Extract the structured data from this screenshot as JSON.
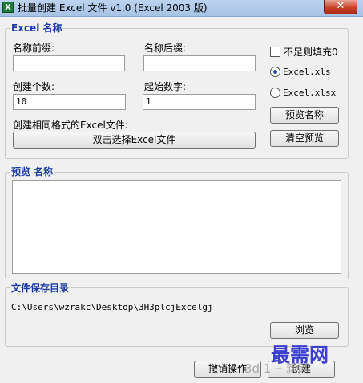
{
  "window": {
    "title": "批量创建 Excel 文件 v1.0 (Excel 2003 版)",
    "icon_text": "X",
    "close_glyph": "✕"
  },
  "name_group": {
    "title": "Excel 名称",
    "prefix_label": "名称前缀:",
    "prefix_value": "",
    "suffix_label": "名称后缀:",
    "suffix_value": "",
    "count_label": "创建个数:",
    "count_value": "10",
    "start_label": "起始数字:",
    "start_value": "1",
    "template_label": "创建相同格式的Excel文件:",
    "template_button": "双击选择Excel文件",
    "pad_checkbox_label": "不足则填充0",
    "pad_checked": false,
    "format_options": [
      "Excel.xls",
      "Excel.xlsx"
    ],
    "format_selected": "Excel.xls",
    "preview_button": "预览名称",
    "clear_button": "清空预览"
  },
  "preview_group": {
    "title": "预览 名称",
    "content": ""
  },
  "save_group": {
    "title": "文件保存目录",
    "path": "C:\\Users\\wzrakc\\Desktop\\3H3plcjExcelgj",
    "browse_button": "浏览"
  },
  "footer": {
    "undo_button": "撤销操作",
    "create_button": "创建"
  },
  "watermark": {
    "text": "最需网",
    "subtext": "3d 1 ┈ 新网"
  },
  "colors": {
    "group_title": "#1a3aa8",
    "watermark": "#3b3fcf",
    "close_button": "#c9422a"
  }
}
